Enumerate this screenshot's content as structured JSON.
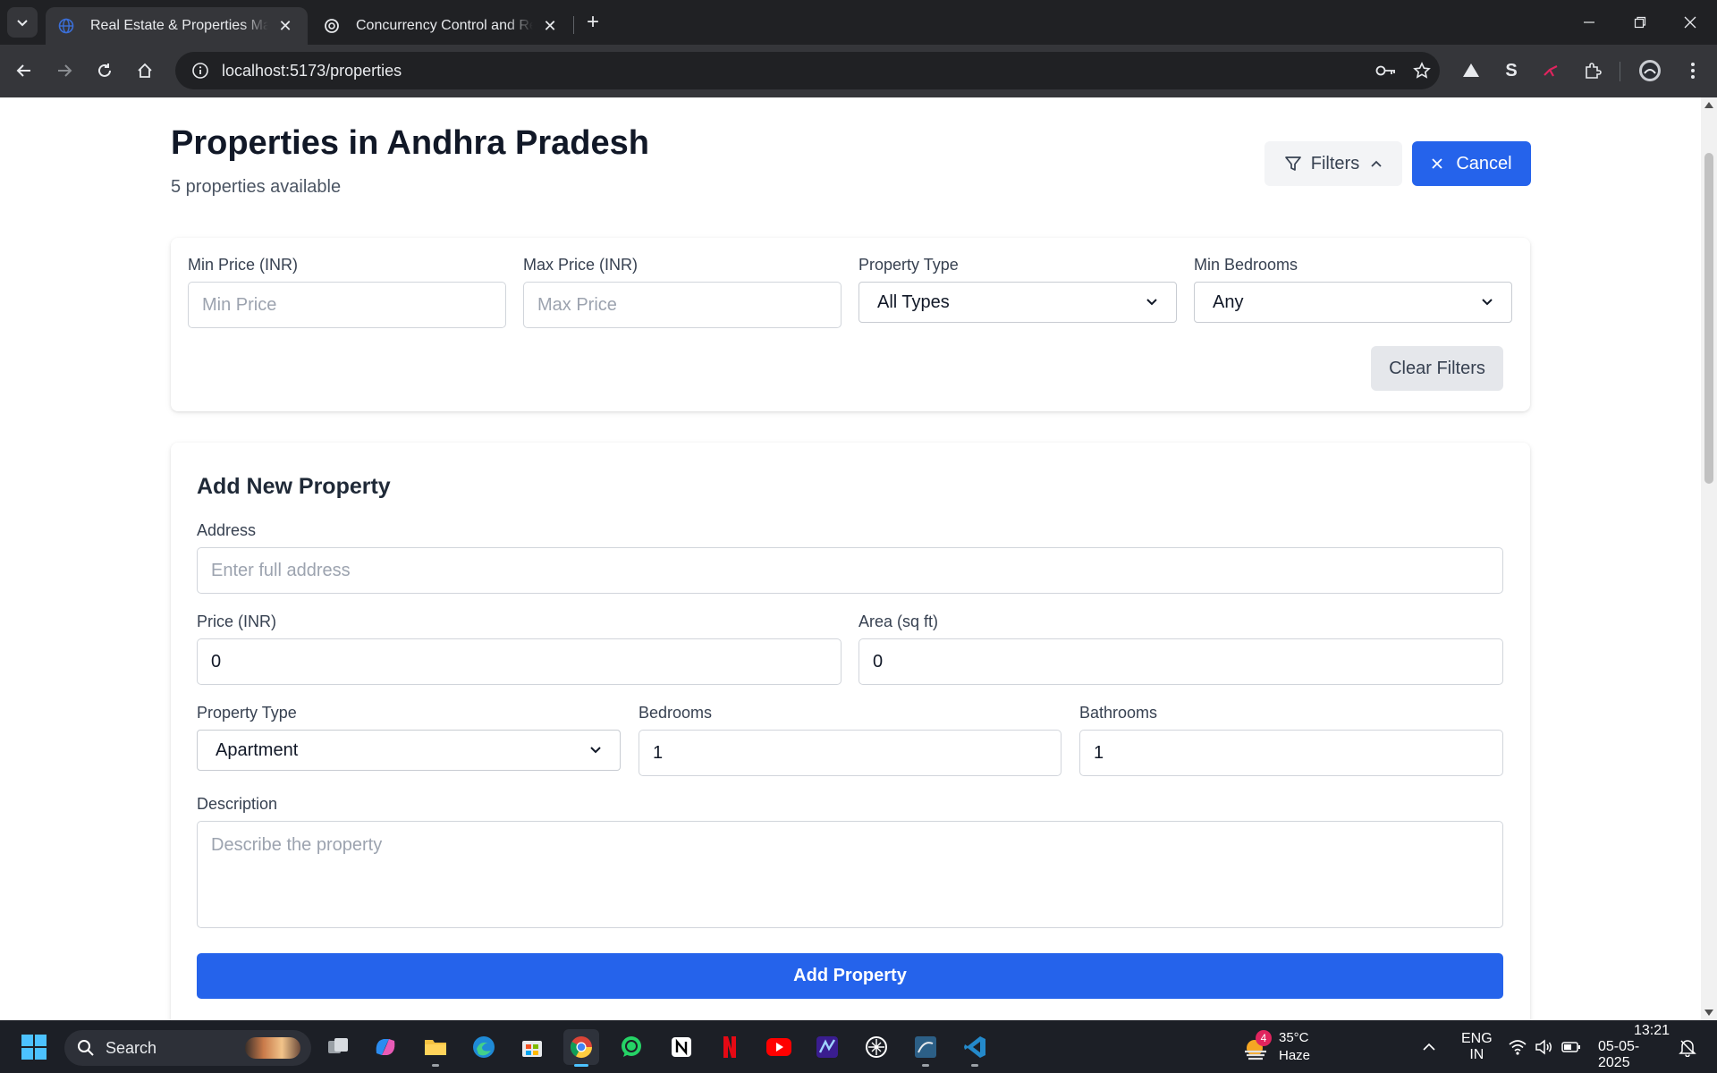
{
  "browser": {
    "tabs": [
      {
        "title": "Real Estate & Properties Manag",
        "active": true
      },
      {
        "title": "Concurrency Control and Recov",
        "active": false
      }
    ],
    "url": "localhost:5173/properties"
  },
  "header": {
    "title": "Properties in Andhra Pradesh",
    "subtitle": "5 properties available",
    "filters_label": "Filters",
    "cancel_label": "Cancel"
  },
  "filters": {
    "min_price": {
      "label": "Min Price (INR)",
      "placeholder": "Min Price"
    },
    "max_price": {
      "label": "Max Price (INR)",
      "placeholder": "Max Price"
    },
    "property_type": {
      "label": "Property Type",
      "value": "All Types"
    },
    "min_bedrooms": {
      "label": "Min Bedrooms",
      "value": "Any"
    },
    "clear_label": "Clear Filters"
  },
  "add_property": {
    "title": "Add New Property",
    "address": {
      "label": "Address",
      "placeholder": "Enter full address"
    },
    "price": {
      "label": "Price (INR)",
      "value": "0"
    },
    "area": {
      "label": "Area (sq ft)",
      "value": "0"
    },
    "property_type": {
      "label": "Property Type",
      "value": "Apartment"
    },
    "bedrooms": {
      "label": "Bedrooms",
      "value": "1"
    },
    "bathrooms": {
      "label": "Bathrooms",
      "value": "1"
    },
    "description": {
      "label": "Description",
      "placeholder": "Describe the property"
    },
    "submit_label": "Add Property"
  },
  "taskbar": {
    "search_label": "Search",
    "weather_badge": "4",
    "weather_temp": "35°C",
    "weather_desc": "Haze",
    "lang_line1": "ENG",
    "lang_line2": "IN",
    "time": "13:21",
    "date": "05-05-2025"
  },
  "colors": {
    "primary": "#2563eb",
    "browser_frame": "#202124",
    "browser_toolbar": "#35363a",
    "taskbar": "#1c1f26"
  }
}
